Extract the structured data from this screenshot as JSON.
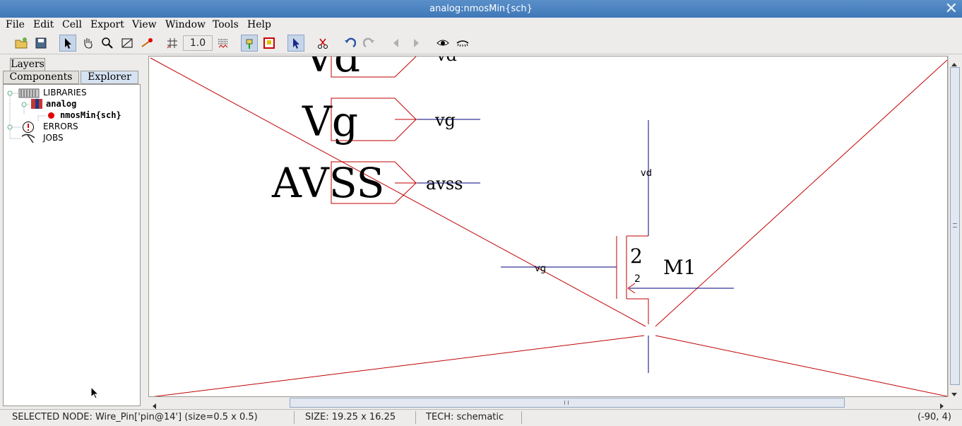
{
  "window": {
    "title": "analog:nmosMin{sch}",
    "close_icon": "close-icon"
  },
  "menu": [
    "File",
    "Edit",
    "Cell",
    "Export",
    "View",
    "Window",
    "Tools",
    "Help"
  ],
  "toolbar": {
    "zoom_value": "1.0",
    "icons": [
      "open-folder-icon",
      "save-icon",
      "select-arrow-icon",
      "pan-hand-icon",
      "zoom-icon",
      "outline-edit-icon",
      "measure-icon",
      "grid-icon",
      "grid-align-icon",
      "select-special-icon",
      "toggle-instance-icon",
      "select-objects-icon",
      "cut-icon",
      "undo-icon",
      "redo-icon",
      "back-icon",
      "forward-icon",
      "show-icon",
      "hide-icon"
    ]
  },
  "left_panel": {
    "tabs": {
      "layers": "Layers",
      "components": "Components",
      "explorer": "Explorer"
    },
    "tree": {
      "libraries": "LIBRARIES",
      "analog": "analog",
      "cell": "nmosMin{sch}",
      "errors": "ERRORS",
      "jobs": "JOBS"
    }
  },
  "schematic": {
    "export_vd_label": "Vd",
    "export_vd_name": "vd",
    "export_vg_label": "Vg",
    "export_vg_name": "vg",
    "export_avss_label": "AVSS",
    "export_avss_name": "avss",
    "transistor_name": "M1",
    "transistor_width": "2",
    "transistor_length": "2",
    "net_drain": "vd",
    "net_gate": "vg",
    "highlight_color": "#c00000",
    "wire_color": "#00007f"
  },
  "status": {
    "selected": "SELECTED NODE: Wire_Pin['pin@14'] (size=0.5 x 0.5)",
    "size": "SIZE: 19.25 x 16.25",
    "tech": "TECH: schematic",
    "coords": "(-90, 4)"
  }
}
